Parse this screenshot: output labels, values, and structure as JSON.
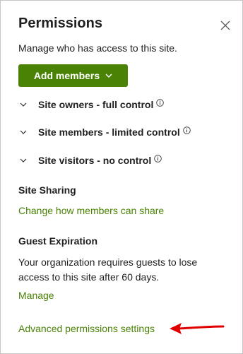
{
  "panel": {
    "title": "Permissions",
    "subtitle": "Manage who has access to this site.",
    "add_members_label": "Add members",
    "groups": [
      {
        "label": "Site owners - full control"
      },
      {
        "label": "Site members - limited control"
      },
      {
        "label": "Site visitors - no control"
      }
    ],
    "site_sharing": {
      "heading": "Site Sharing",
      "link": "Change how members can share"
    },
    "guest_expiration": {
      "heading": "Guest Expiration",
      "text": "Your organization requires guests to lose access to this site after 60 days.",
      "link": "Manage"
    },
    "advanced_link": "Advanced permissions settings"
  },
  "colors": {
    "accent": "#498205",
    "arrow": "#e00000"
  },
  "icons": [
    "close-icon",
    "chevron-down-icon",
    "info-icon",
    "red-arrow-annotation"
  ]
}
